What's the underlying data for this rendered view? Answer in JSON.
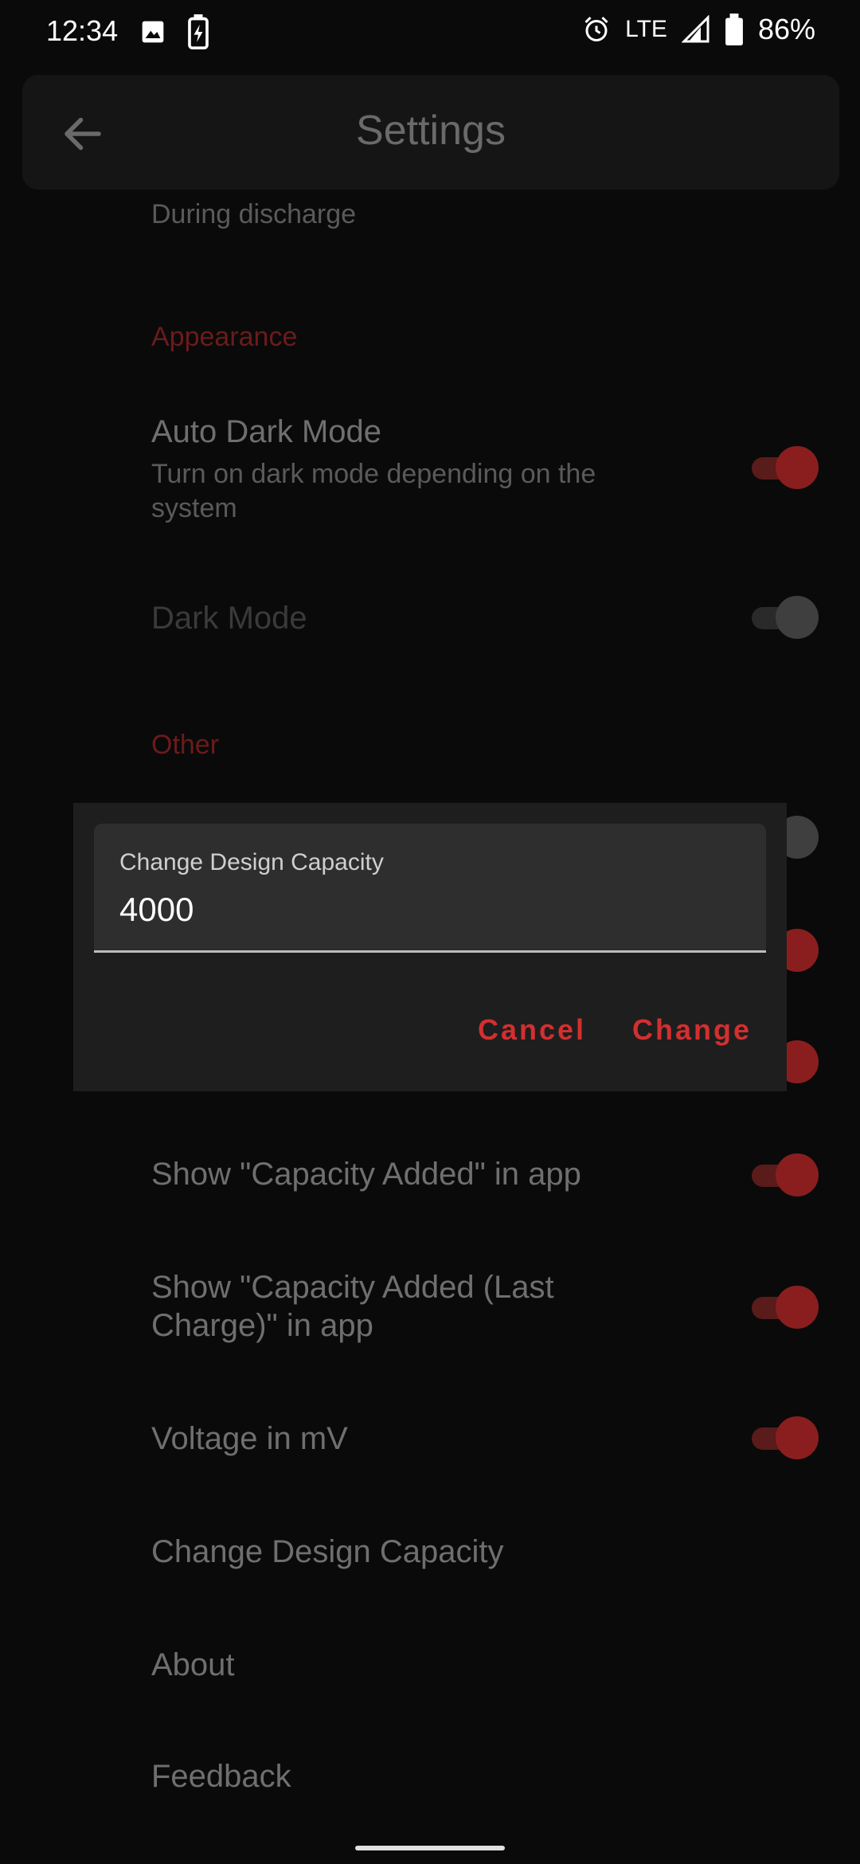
{
  "status_bar": {
    "time": "12:34",
    "network": "LTE",
    "battery_percent": "86%",
    "icons": [
      "image-icon",
      "battery-charging-icon",
      "alarm-icon",
      "signal-icon",
      "battery-icon"
    ]
  },
  "app_bar": {
    "title": "Settings",
    "back_icon": "arrow-back-icon"
  },
  "settings": {
    "during_discharge": "During discharge",
    "appearance_header": "Appearance",
    "auto_dark_mode": {
      "title": "Auto Dark Mode",
      "summary_line1": "Turn on dark mode depending on the",
      "summary_line2": "system",
      "enabled": true
    },
    "dark_mode": {
      "title": "Dark Mode",
      "enabled": false
    },
    "other_header": "Other",
    "capacity_added": {
      "title": "Show \"Capacity Added\" in app",
      "enabled": true
    },
    "capacity_added_last": {
      "title_line1": "Show \"Capacity Added (Last",
      "title_line2": "Charge)\" in app",
      "enabled": true
    },
    "voltage_mv": {
      "title": "Voltage in mV",
      "enabled": true
    },
    "change_design_capacity": "Change Design Capacity",
    "about": "About",
    "feedback": "Feedback"
  },
  "dialog": {
    "field_label": "Change Design Capacity",
    "field_value": "4000",
    "cancel_label": "Cancel",
    "change_label": "Change"
  },
  "colors": {
    "accent": "#d32f2f",
    "background": "#0a0a0a",
    "dialog": "#1e1e1e"
  }
}
